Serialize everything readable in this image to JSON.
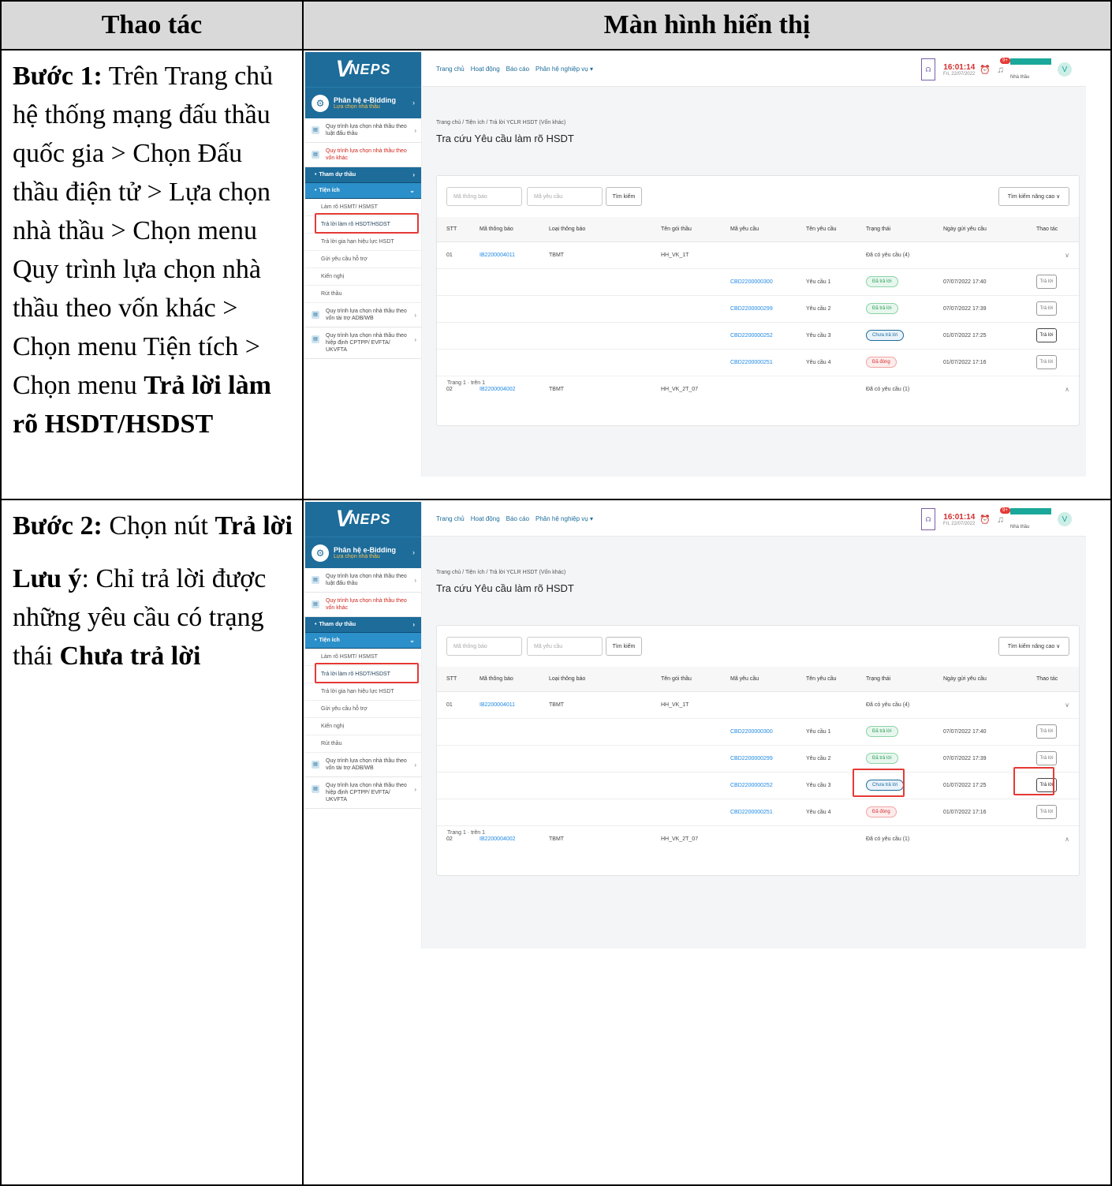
{
  "headers": {
    "left": "Thao tác",
    "right": "Màn hình hiển thị"
  },
  "step1": {
    "label": "Bước 1:",
    "text": " Trên Trang chủ hệ thống mạng đấu thầu quốc gia > Chọn Đấu thầu điện tử > Lựa chọn nhà thầu > Chọn menu Quy trình lựa chọn nhà thầu theo vốn khác > Chọn menu Tiện tích > Chọn menu ",
    "bold_tail": "Trả lời làm rõ HSDT/HSDST"
  },
  "step2": {
    "label": "Bước 2:",
    "text": " Chọn nút ",
    "bold_tail": "Trả lời",
    "note_label": "Lưu ý",
    "note_text": ": Chỉ trả lời được những yêu cầu có trạng thái ",
    "note_bold": "Chưa trả lời"
  },
  "app": {
    "logo": "NEPS",
    "module_title": "Phân hệ e-Bidding",
    "module_sub": "Lựa chọn nhà thầu",
    "sidebar_items": [
      "Quy trình lựa chọn nhà thầu theo luật đấu thầu",
      "Quy trình lựa chọn nhà thầu theo vốn khác"
    ],
    "menu_tham_du": "Tham dự thầu",
    "menu_tien_ich": "Tiện ích",
    "sub_items": [
      "Làm rõ HSMT/ HSMST",
      "Trả lời làm rõ HSDT/HSDST",
      "Trả lời gia hạn hiệu lực HSDT",
      "Gửi yêu cầu hỗ trợ",
      "Kiến nghị",
      "Rút thầu"
    ],
    "sidebar_bottom": [
      "Quy trình lựa chọn nhà thầu theo vốn tài trợ ADB/WB",
      "Quy trình lựa chọn nhà thầu theo hiệp định CPTPP/ EVFTA/ UKVFTA"
    ],
    "nav": [
      "Trang chủ",
      "Hoạt động",
      "Báo cáo",
      "Phân hệ nghiệp vụ ▾"
    ],
    "clock_time": "16:01:14",
    "clock_date": "Fri, 22/07/2022",
    "bell_badge": "9+",
    "user_role": "Nhà thầu",
    "user_initial": "V",
    "breadcrumb": "Trang chủ / Tiện ích / Trả lời YCLR HSDT (Vốn khác)",
    "page_title": "Tra cứu Yêu cầu làm rõ HSDT",
    "ph_ma_thong_bao": "Mã thông báo",
    "ph_ma_yeu_cau": "Mã yêu cầu",
    "btn_search": "Tìm kiếm",
    "btn_advanced": "Tìm kiếm nâng cao ∨",
    "columns": [
      "STT",
      "Mã thông báo",
      "Loại thông báo",
      "Tên gói thầu",
      "Mã yêu cầu",
      "Tên yêu cầu",
      "Trạng thái",
      "Ngày gửi yêu cầu",
      "Thao tác"
    ],
    "groups": [
      {
        "stt": "01",
        "code": "IB2200004011",
        "type": "TBMT",
        "package": "HH_VK_1T",
        "status": "Đã có yêu cầu (4)"
      },
      {
        "stt": "02",
        "code": "IB2200004002",
        "type": "TBMT",
        "package": "HH_VK_2T_07",
        "status": "Đã có yêu cầu (1)"
      }
    ],
    "requests": [
      {
        "code": "CBD2200000300",
        "name": "Yêu cầu 1",
        "status": "Đã trả lời",
        "date": "07/07/2022 17:40",
        "action": "Trả lời"
      },
      {
        "code": "CBD2200000299",
        "name": "Yêu cầu 2",
        "status": "Đã trả lời",
        "date": "07/07/2022 17:39",
        "action": "Trả lời"
      },
      {
        "code": "CBD2200000252",
        "name": "Yêu cầu 3",
        "status": "Chưa trả lời",
        "date": "01/07/2022 17:25",
        "action": "Trả lời"
      },
      {
        "code": "CBD2200000251",
        "name": "Yêu cầu 4",
        "status": "Đã đóng",
        "date": "01/07/2022 17:16",
        "action": "Trả lời"
      }
    ],
    "pager": "Trang  1   ·  trên 1"
  }
}
